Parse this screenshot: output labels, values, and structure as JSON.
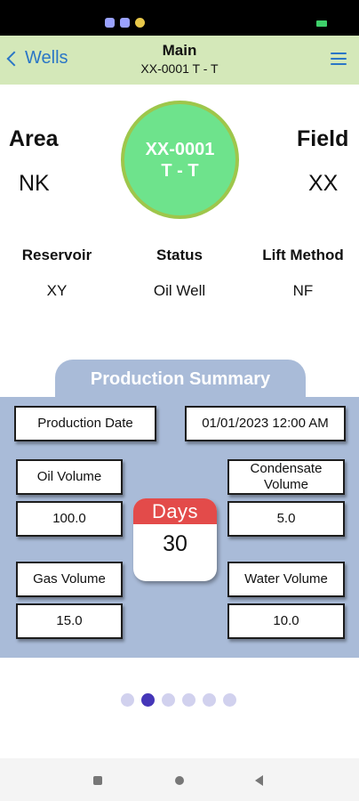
{
  "header": {
    "back_label": "Wells",
    "title": "Main",
    "subtitle": "XX-0001 T - T"
  },
  "well": {
    "area_label": "Area",
    "area_value": "NK",
    "field_label": "Field",
    "field_value": "XX",
    "badge_line1": "XX-0001",
    "badge_line2": "T - T",
    "reservoir_label": "Reservoir",
    "reservoir_value": "XY",
    "status_label": "Status",
    "status_value": "Oil Well",
    "lift_label": "Lift Method",
    "lift_value": "NF"
  },
  "production_summary": {
    "title": "Production Summary",
    "date_label": "Production Date",
    "date_value": "01/01/2023 12:00 AM",
    "oil_label": "Oil Volume",
    "oil_value": "100.0",
    "condensate_label_line1": "Condensate",
    "condensate_label_line2": "Volume",
    "condensate_value": "5.0",
    "gas_label": "Gas Volume",
    "gas_value": "15.0",
    "water_label": "Water Volume",
    "water_value": "10.0",
    "days_label": "Days",
    "days_value": "30"
  },
  "pager": {
    "count": 6,
    "active_index": 1
  },
  "colors": {
    "header_bg": "#d4e8b9",
    "accent": "#2a76c6",
    "badge_fill": "#6ee38c",
    "badge_border": "#9ec64b",
    "panel_bg": "#a9bbd8",
    "calendar_red": "#e34b4a",
    "dot_active": "#4536b8",
    "dot_inactive": "#d1d1ee"
  }
}
